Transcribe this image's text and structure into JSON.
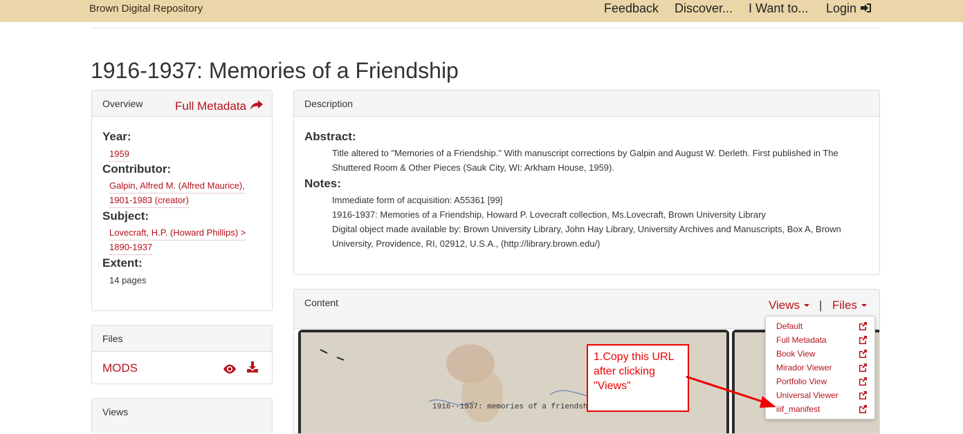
{
  "header": {
    "brand": "Brown Digital Repository",
    "nav": {
      "feedback": "Feedback",
      "discover": "Discover...",
      "i_want_to": "I Want to...",
      "login": "Login"
    }
  },
  "page": {
    "title": "1916-1937: Memories of a Friendship"
  },
  "overview": {
    "heading": "Overview",
    "full_metadata": "Full Metadata",
    "year_label": "Year:",
    "year": "1959",
    "contributor_label": "Contributor:",
    "contributor_line1": "Galpin, Alfred M. (Alfred Maurice),",
    "contributor_line2": "1901-1983 (creator)",
    "subject_label": "Subject:",
    "subject_line1": "Lovecraft, H.P. (Howard Phillips) >",
    "subject_line2": "1890-1937",
    "extent_label": "Extent:",
    "extent": "14 pages"
  },
  "files_panel": {
    "heading": "Files",
    "mods": "MODS"
  },
  "views_panel": {
    "heading": "Views"
  },
  "description": {
    "heading": "Description",
    "abstract_label": "Abstract:",
    "abstract_line1": "Title altered to \"Memories of a Friendship.\" With manuscript corrections by Galpin and August W. Derleth. First published in The",
    "abstract_line2": "Shuttered Room & Other Pieces (Sauk City, WI: Arkham House, 1959).",
    "notes_label": "Notes:",
    "note1": "Immediate form of acquisition: A55361 [99]",
    "note2": "1916-1937: Memories of a Friendship, Howard P. Lovecraft collection, Ms.Lovecraft, Brown University Library",
    "note3_line1": "Digital object made available by: Brown University Library, John Hay Library, University Archives and Manuscripts, Box A, Brown",
    "note3_line2": "University, Providence, RI, 02912, U.S.A., (http://library.brown.edu/)"
  },
  "content": {
    "heading": "Content",
    "views_toggle": "Views",
    "separator": "|",
    "files_toggle": "Files",
    "views_menu": [
      "Default",
      "Full Metadata",
      "Book View",
      "Mirador Viewer",
      "Portfolio View",
      "Universal Viewer",
      "iiif_manifest"
    ],
    "typed_text": "1916--1937: memories of a friendship."
  },
  "annotation": {
    "line1": "1.Copy this URL",
    "line2": "after clicking",
    "line3": "\"Views\""
  },
  "colors": {
    "accent": "#b5121b",
    "topbar": "#ead6a8",
    "annotation": "#ee0000"
  },
  "icons": [
    "login-icon",
    "share-arrow-icon",
    "eye-icon",
    "download-icon",
    "external-link-icon",
    "caret-down-icon"
  ]
}
